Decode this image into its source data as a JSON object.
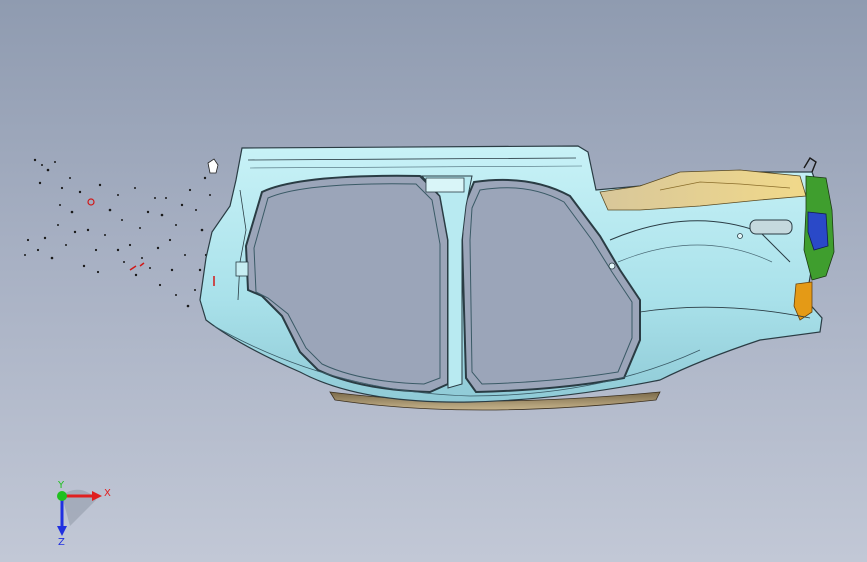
{
  "viewport": {
    "background_top": "#8f9bb0",
    "background_bottom": "#c2c8d6",
    "model": {
      "name": "body-side-assembly",
      "primary_color": "#aee3ec",
      "edge_color": "#2a3c44",
      "accent_colors": [
        "#e8cf86",
        "#3f9e2e",
        "#2a49c8",
        "#e49a16",
        "#d11a1a"
      ]
    },
    "triad": {
      "x_label": "X",
      "y_label": "Y",
      "z_label": "Z",
      "x_color": "#e02020",
      "y_color": "#20c020",
      "z_color": "#2030e0"
    }
  }
}
